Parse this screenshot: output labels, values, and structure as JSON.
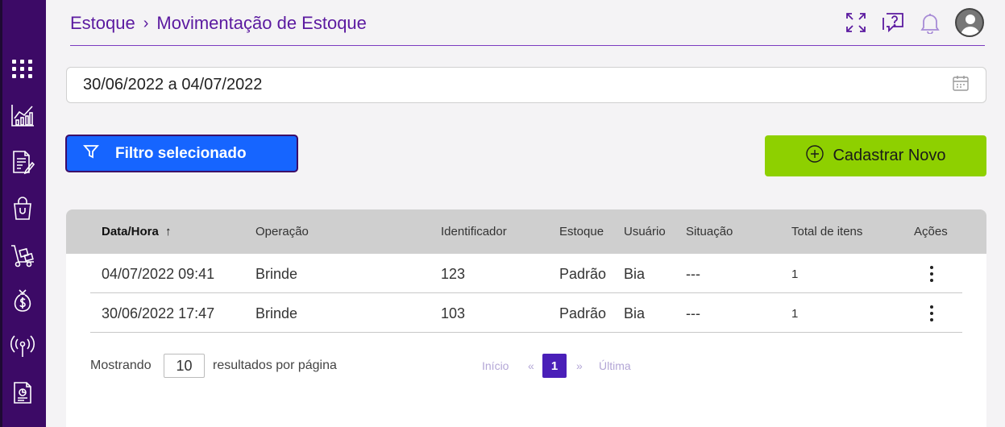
{
  "breadcrumb": {
    "parent": "Estoque",
    "separator": "›",
    "current": "Movimentação de Estoque"
  },
  "date_range": {
    "value": "30/06/2022 a 04/07/2022"
  },
  "filter_button": {
    "label": "Filtro selecionado"
  },
  "new_button": {
    "label": "Cadastrar Novo"
  },
  "table": {
    "headers": {
      "datetime": "Data/Hora",
      "sort_arrow": "↑",
      "operation": "Operação",
      "identifier": "Identificador",
      "stock": "Estoque",
      "user": "Usuário",
      "status": "Situação",
      "total_items": "Total de itens",
      "actions": "Ações"
    },
    "rows": [
      {
        "datetime": "04/07/2022 09:41",
        "operation": "Brinde",
        "identifier": "123",
        "stock": "Padrão",
        "user": "Bia",
        "status": "---",
        "total_items": "1"
      },
      {
        "datetime": "30/06/2022 17:47",
        "operation": "Brinde",
        "identifier": "103",
        "stock": "Padrão",
        "user": "Bia",
        "status": "---",
        "total_items": "1"
      }
    ]
  },
  "pagination": {
    "showing_label": "Mostrando",
    "per_page_value": "10",
    "per_page_suffix": "resultados por página",
    "first": "Início",
    "prev": "«",
    "current_page": "1",
    "next": "»",
    "last": "Última"
  },
  "colors": {
    "sidebar": "#3c0a66",
    "accent_purple": "#5b1aa0",
    "filter_blue": "#1665ff",
    "new_green": "#8ed000",
    "page_active": "#4a1fb8"
  },
  "icons": {
    "sidebar": [
      "grid-icon",
      "chart-icon",
      "document-edit-icon",
      "shopping-bag-icon",
      "hand-truck-icon",
      "money-bag-icon",
      "antenna-icon",
      "report-icon"
    ],
    "header": [
      "fullscreen-icon",
      "help-chat-icon",
      "bell-icon",
      "user-avatar-icon"
    ]
  }
}
